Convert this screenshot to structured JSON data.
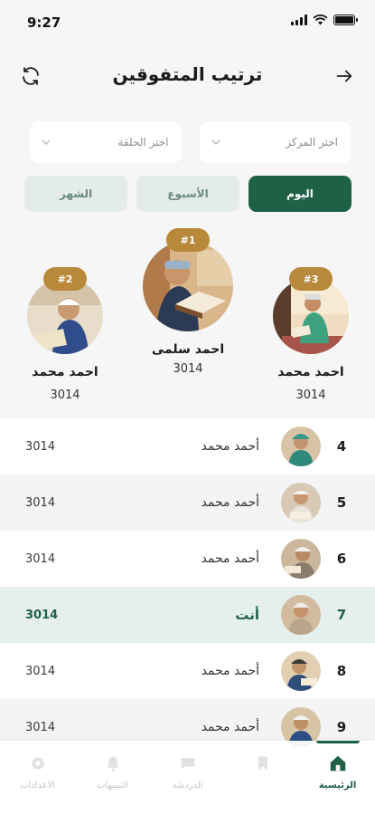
{
  "status": {
    "time": "9:27"
  },
  "header": {
    "title": "ترتيب المتفوقين"
  },
  "filters": {
    "center": {
      "placeholder": "اختر المركز"
    },
    "circle": {
      "placeholder": "اختر الحلقة"
    }
  },
  "tabs": [
    {
      "label": "اليوم",
      "active": true
    },
    {
      "label": "الأسبوع",
      "active": false
    },
    {
      "label": "الشهر",
      "active": false
    }
  ],
  "podium": {
    "first": {
      "rank": "#1",
      "name": "احمد سلمى",
      "score": "3014"
    },
    "second": {
      "rank": "#2",
      "name": "احمد محمد",
      "score": "3014"
    },
    "third": {
      "rank": "#3",
      "name": "احمد محمد",
      "score": "3014"
    }
  },
  "rows": [
    {
      "rank": "4",
      "name": "أحمد محمد",
      "score": "3014"
    },
    {
      "rank": "5",
      "name": "أحمد محمد",
      "score": "3014"
    },
    {
      "rank": "6",
      "name": "أحمد محمد",
      "score": "3014"
    },
    {
      "rank": "7",
      "name": "أنت",
      "score": "3014"
    },
    {
      "rank": "8",
      "name": "أحمد محمد",
      "score": "3014"
    },
    {
      "rank": "9",
      "name": "أحمد محمد",
      "score": "3014"
    }
  ],
  "nav": {
    "home": "الرئيسية",
    "item2": "",
    "chat": "الدردشة",
    "notifications": "التنبيهات",
    "settings": "الاعدادات"
  },
  "colors": {
    "primary": "#1f6147",
    "gold": "#b8893a",
    "highlight_row": "#e5efeb"
  }
}
